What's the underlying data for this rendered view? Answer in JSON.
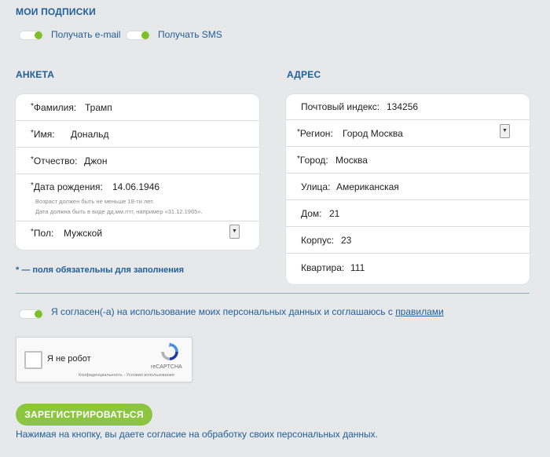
{
  "subscriptions": {
    "title": "МОИ ПОДПИСКИ",
    "email_label": "Получать e-mail",
    "sms_label": "Получать SMS"
  },
  "profile": {
    "title": "АНКЕТА",
    "lastname_label": "Фамилия:",
    "lastname_value": "Трамп",
    "firstname_label": "Имя:",
    "firstname_value": "Дональд",
    "patronymic_label": "Отчество:",
    "patronymic_value": "Джон",
    "birthdate_label": "Дата рождения:",
    "birthdate_value": "14.06.1946",
    "birthdate_hint1": "Возраст должен быть не меньше 18-ти лет.",
    "birthdate_hint2": "Дата должна быть в виде дд.мм.гггг, например «31.12.1965».",
    "gender_label": "Пол:",
    "gender_value": "Мужской",
    "required_star": "*"
  },
  "address": {
    "title": "АДРЕС",
    "zip_label": "Почтовый индекс:",
    "zip_value": "134256",
    "region_label": "Регион:",
    "region_value": "Город Москва",
    "city_label": "Город:",
    "city_value": "Москва",
    "street_label": "Улица:",
    "street_value": "Американская",
    "house_label": "Дом:",
    "house_value": "21",
    "building_label": "Корпус:",
    "building_value": "23",
    "apartment_label": "Квартира:",
    "apartment_value": "111"
  },
  "required_note": "* — поля обязательны для заполнения",
  "consent": {
    "text": "Я согласен(-а) на использование моих персональных данных и соглашаюсь с ",
    "link": "правилами"
  },
  "captcha": {
    "label": "Я не робот",
    "brand": "reCAPTCHA",
    "footer": "Конфиденциальность - Условия использования"
  },
  "register_button": "ЗАРЕГИСТРИРОВАТЬСЯ",
  "footer_note": "Нажимая на кнопку, вы даете согласие на обработку своих персональных данных.",
  "colors": {
    "accent": "#1f5f9a",
    "toggle_on": "#7dbf2a",
    "button": "#8cc641",
    "background": "#e7e8e9"
  }
}
